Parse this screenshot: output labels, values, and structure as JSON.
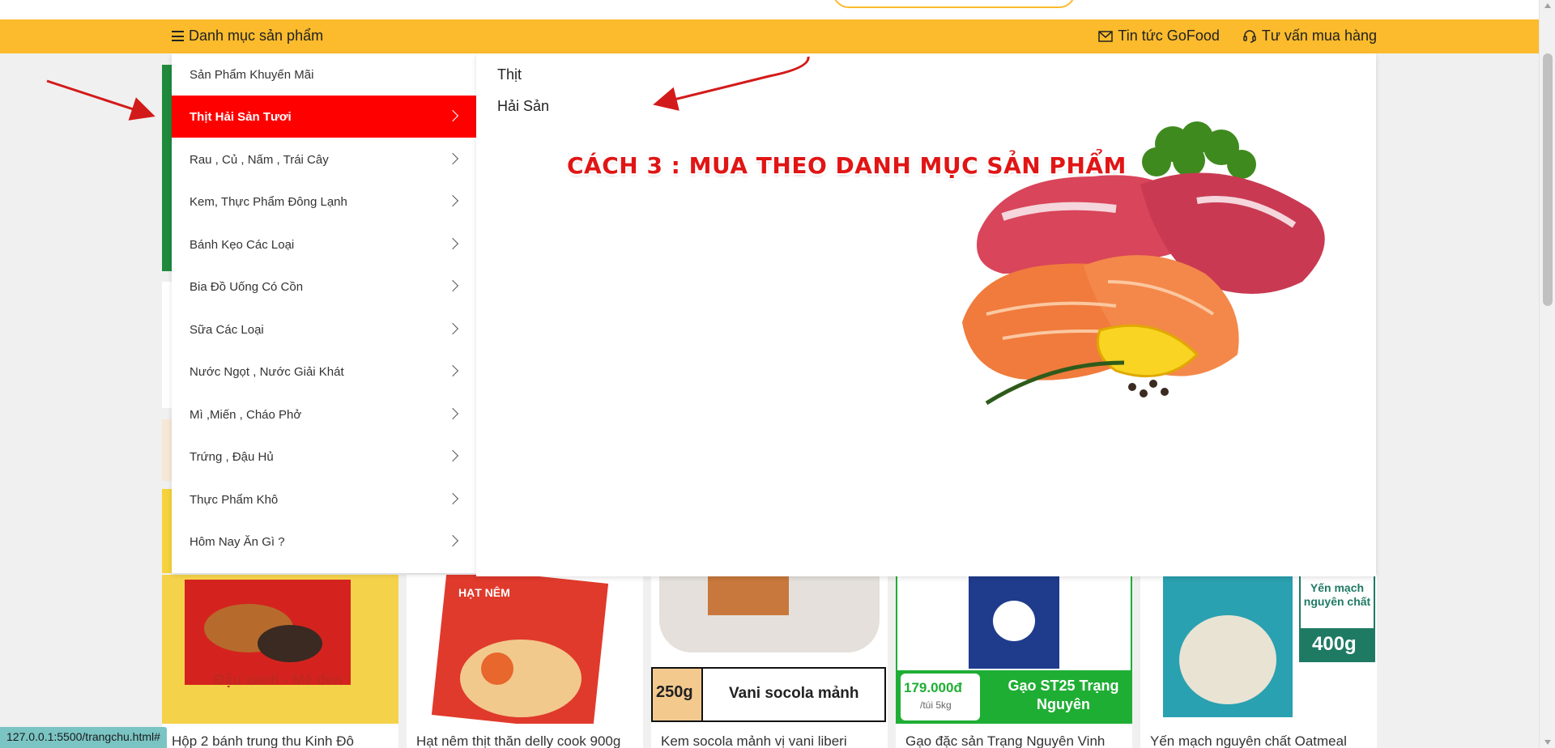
{
  "header": {
    "category_toggle": "Danh mục sản phẩm",
    "news_link": "Tin tức GoFood",
    "support_link": "Tư vấn mua hàng"
  },
  "category_menu": {
    "items": [
      {
        "label": "Sản Phẩm Khuyến Mãi",
        "active": false,
        "has_submenu": false
      },
      {
        "label": "Thịt Hải Sản Tươi",
        "active": true,
        "has_submenu": true
      },
      {
        "label": "Rau , Củ , Nấm , Trái Cây",
        "active": false,
        "has_submenu": true
      },
      {
        "label": "Kem, Thực Phẩm Đông Lạnh",
        "active": false,
        "has_submenu": true
      },
      {
        "label": "Bánh Kẹo Các Loại",
        "active": false,
        "has_submenu": true
      },
      {
        "label": "Bia Đồ Uống Có Cồn",
        "active": false,
        "has_submenu": true
      },
      {
        "label": "Sữa Các Loại",
        "active": false,
        "has_submenu": true
      },
      {
        "label": "Nước Ngọt , Nước Giải Khát",
        "active": false,
        "has_submenu": true
      },
      {
        "label": "Mì ,Miến , Cháo Phở",
        "active": false,
        "has_submenu": true
      },
      {
        "label": "Trứng , Đậu Hủ",
        "active": false,
        "has_submenu": true
      },
      {
        "label": "Thực Phẩm Khô",
        "active": false,
        "has_submenu": true
      },
      {
        "label": "Hôm Nay Ăn Gì ?",
        "active": false,
        "has_submenu": true
      }
    ]
  },
  "submenu": {
    "items": [
      "Thịt",
      "Hải Sản"
    ],
    "annotation": "CÁCH 3 : MUA THEO DANH MỤC SẢN PHẨM"
  },
  "products": [
    {
      "title": "Hộp 2 bánh trung thu Kinh Đô",
      "image_caption": "Đậu xanh - Mè đen"
    },
    {
      "title": "Hạt nêm thịt thăn delly cook 900g",
      "image_caption": "HẠT NÊM"
    },
    {
      "title": "Kem socola mảnh vị vani liberi",
      "image_caption_weight": "250g",
      "image_caption": "Vani socola mảnh"
    },
    {
      "title": "Gạo đặc sản Trạng Nguyên Vinh",
      "image_price": "179.000đ",
      "image_unit": "/túi 5kg",
      "image_caption": "Gạo ST25 Trạng Nguyên"
    },
    {
      "title": "Yến mạch nguyên chất Oatmeal",
      "image_caption": "Yến mạch nguyên chất",
      "image_weight": "400g"
    }
  ],
  "status_bar": {
    "url": "127.0.0.1:5500/trangchu.html#"
  },
  "colors": {
    "brand_yellow": "#fbbb2c",
    "active_red": "#ff0000",
    "accent_green": "#1f8a3b"
  },
  "icons": {
    "menu": "hamburger-icon",
    "news": "envelope-icon",
    "support": "headset-icon",
    "chevron": "chevron-right-icon"
  }
}
